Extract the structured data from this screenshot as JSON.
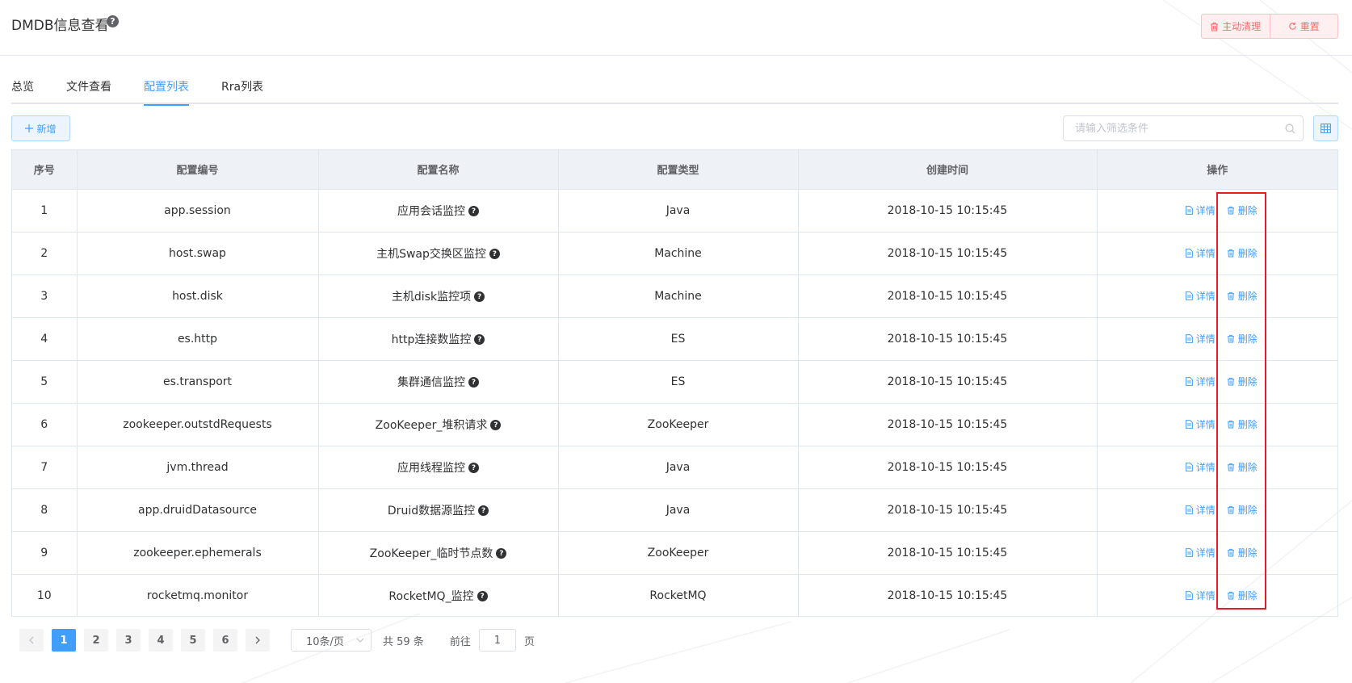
{
  "header": {
    "title": "DMDB信息查看",
    "clean_label": "主动清理",
    "reset_label": "重置"
  },
  "tabs": [
    {
      "label": "总览"
    },
    {
      "label": "文件查看"
    },
    {
      "label": "配置列表"
    },
    {
      "label": "Rra列表"
    }
  ],
  "toolbar": {
    "add_label": "新增",
    "search_placeholder": "请输入筛选条件"
  },
  "table": {
    "columns": [
      "序号",
      "配置编号",
      "配置名称",
      "配置类型",
      "创建时间",
      "操作"
    ],
    "rows": [
      {
        "no": "1",
        "code": "app.session",
        "name": "应用会话监控",
        "type": "Java",
        "created": "2018-10-15 10:15:45"
      },
      {
        "no": "2",
        "code": "host.swap",
        "name": "主机Swap交换区监控",
        "type": "Machine",
        "created": "2018-10-15 10:15:45"
      },
      {
        "no": "3",
        "code": "host.disk",
        "name": "主机disk监控项",
        "type": "Machine",
        "created": "2018-10-15 10:15:45"
      },
      {
        "no": "4",
        "code": "es.http",
        "name": "http连接数监控",
        "type": "ES",
        "created": "2018-10-15 10:15:45"
      },
      {
        "no": "5",
        "code": "es.transport",
        "name": "集群通信监控",
        "type": "ES",
        "created": "2018-10-15 10:15:45"
      },
      {
        "no": "6",
        "code": "zookeeper.outstdRequests",
        "name": "ZooKeeper_堆积请求",
        "type": "ZooKeeper",
        "created": "2018-10-15 10:15:45"
      },
      {
        "no": "7",
        "code": "jvm.thread",
        "name": "应用线程监控",
        "type": "Java",
        "created": "2018-10-15 10:15:45"
      },
      {
        "no": "8",
        "code": "app.druidDatasource",
        "name": "Druid数据源监控",
        "type": "Java",
        "created": "2018-10-15 10:15:45"
      },
      {
        "no": "9",
        "code": "zookeeper.ephemerals",
        "name": "ZooKeeper_临时节点数",
        "type": "ZooKeeper",
        "created": "2018-10-15 10:15:45"
      },
      {
        "no": "10",
        "code": "rocketmq.monitor",
        "name": "RocketMQ_监控",
        "type": "RocketMQ",
        "created": "2018-10-15 10:15:45"
      }
    ],
    "detail_label": "详情",
    "delete_label": "删除"
  },
  "pagination": {
    "pages": [
      "1",
      "2",
      "3",
      "4",
      "5",
      "6"
    ],
    "current_page": "1",
    "page_size_label": "10条/页",
    "total_text": "共 59 条",
    "goto_prefix": "前往",
    "goto_value": "1",
    "goto_suffix": "页"
  },
  "colors": {
    "primary": "#409eff",
    "danger": "#f56c6c",
    "highlight": "#e02020"
  },
  "icons": {
    "help": "help-circle-icon",
    "trash": "trash-icon",
    "refresh": "refresh-icon",
    "plus": "plus-icon",
    "search": "search-icon",
    "grid": "table-grid-icon",
    "document": "document-icon",
    "prev": "chevron-left-icon",
    "next": "chevron-right-icon",
    "dropdown": "chevron-down-icon"
  }
}
